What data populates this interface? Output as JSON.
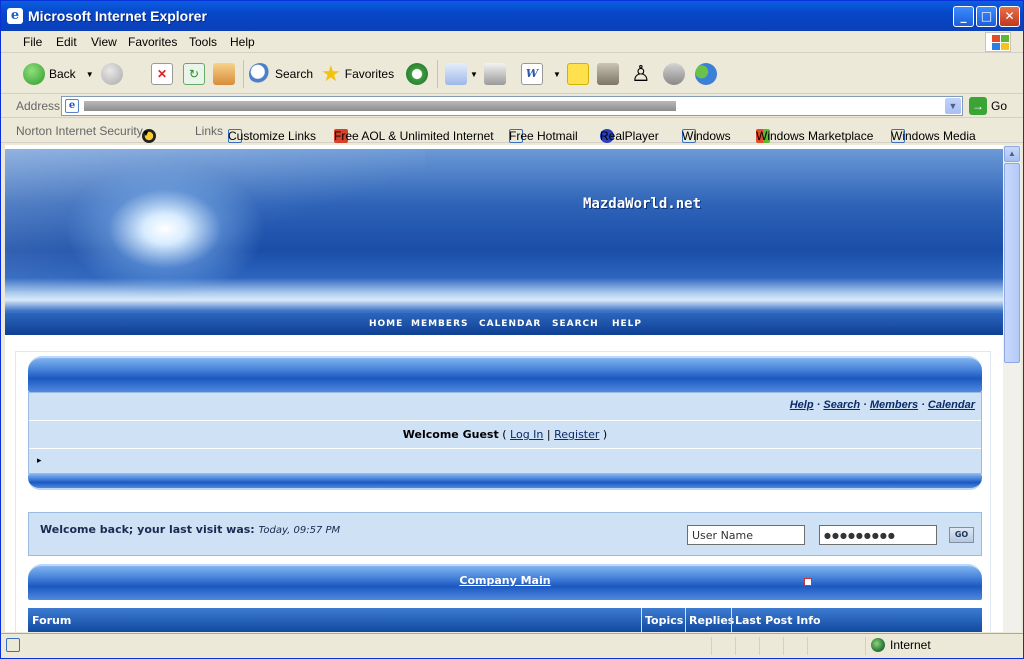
{
  "window": {
    "title": "Microsoft Internet Explorer",
    "controls": {
      "min": "_",
      "max": "□",
      "close": "✕"
    }
  },
  "menu": [
    "File",
    "Edit",
    "View",
    "Favorites",
    "Tools",
    "Help"
  ],
  "toolbar": {
    "back": "Back",
    "search": "Search",
    "favorites": "Favorites"
  },
  "address": {
    "label": "Address",
    "go": "Go"
  },
  "links_bar": {
    "norton": "Norton Internet Security",
    "links_label": "Links",
    "items": [
      "Customize Links",
      "Free AOL & Unlimited Internet",
      "Free Hotmail",
      "RealPlayer",
      "Windows",
      "Windows Marketplace",
      "Windows Media"
    ]
  },
  "site": {
    "name": "MazdaWorld.net",
    "nav": [
      "HOME",
      "MEMBERS",
      "CALENDAR",
      "SEARCH",
      "HELP"
    ],
    "top_links": [
      "Help",
      "Search",
      "Members",
      "Calendar"
    ],
    "welcome": {
      "prefix": "Welcome Guest",
      "open": " ( ",
      "login": "Log In",
      "sep": " | ",
      "register": "Register",
      "close": " )"
    },
    "arrow": "▸",
    "last_visit": {
      "label": "Welcome back; your last visit was:",
      "value": "Today, 09:57 PM"
    },
    "username_placeholder": "User Name",
    "password_mask": "●●●●●●●●●",
    "go_btn": "GO",
    "category": "Company Main",
    "columns": [
      "Forum",
      "Topics",
      "Replies",
      "Last Post Info"
    ]
  },
  "status": {
    "zone": "Internet"
  }
}
